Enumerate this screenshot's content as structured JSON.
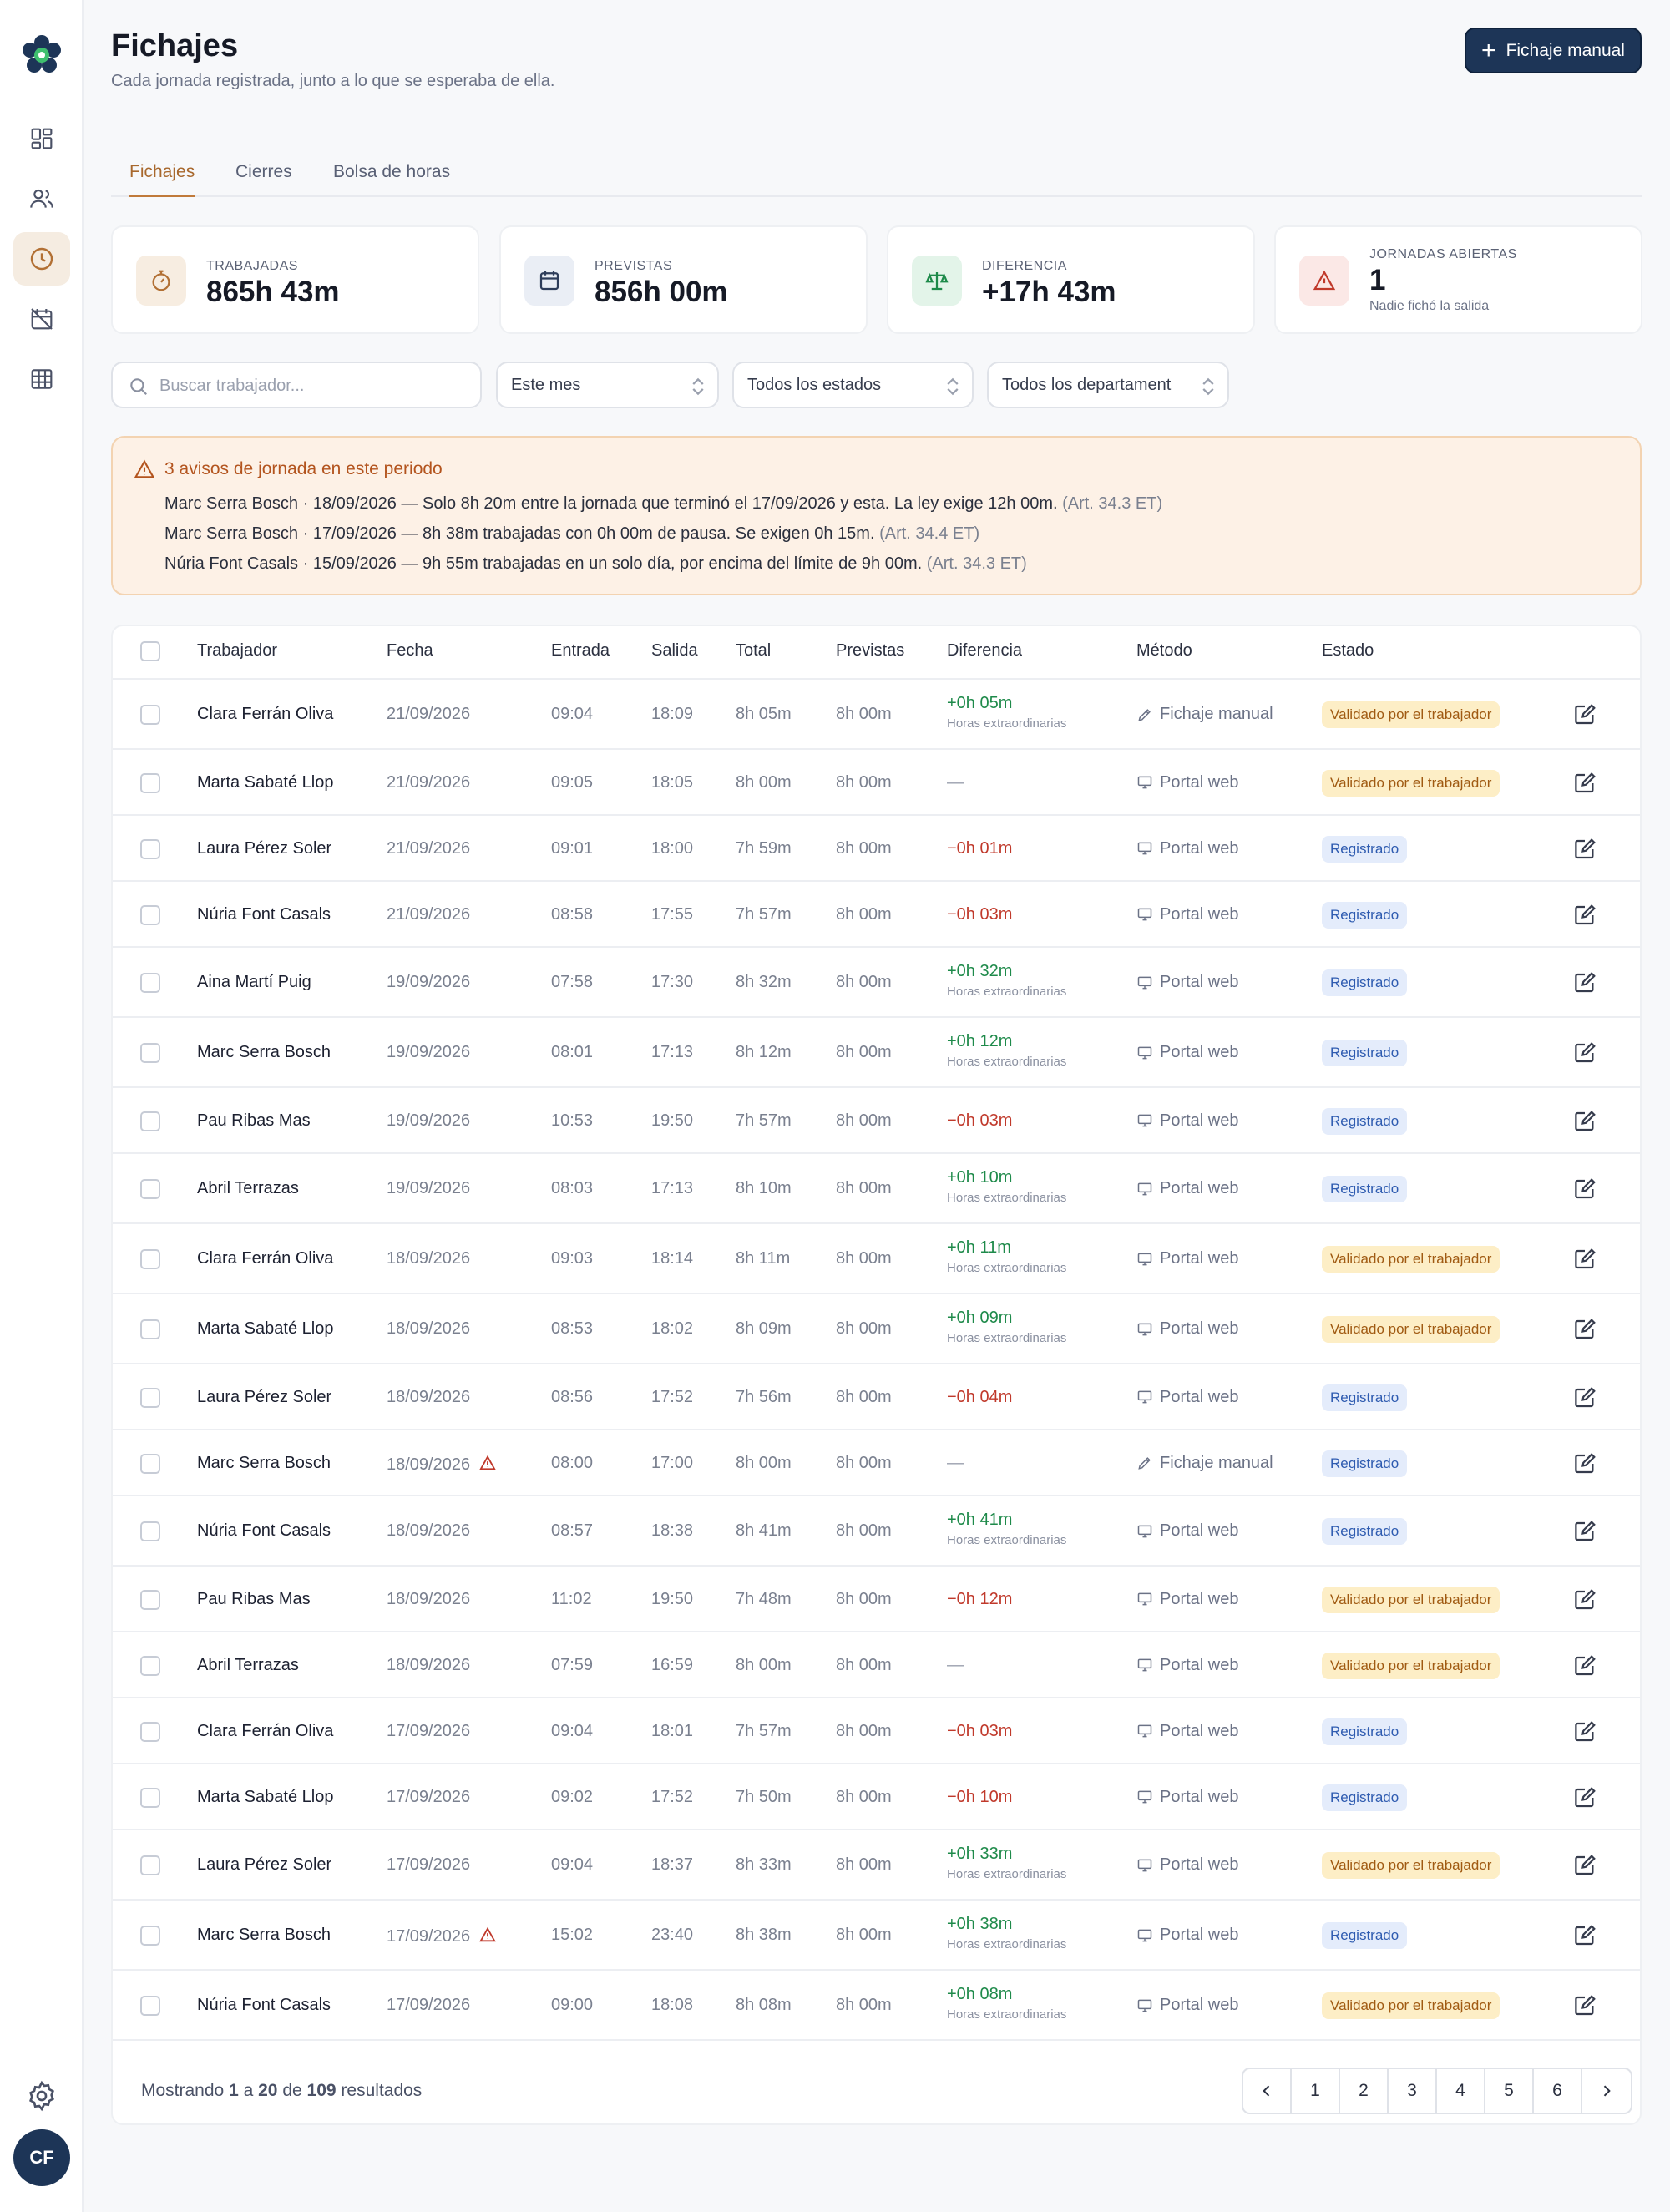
{
  "sidebar": {
    "items": [
      {
        "name": "dashboard",
        "icon": "grid-icon"
      },
      {
        "name": "users",
        "icon": "users-icon"
      },
      {
        "name": "fichajes",
        "icon": "clock-icon",
        "active": true
      },
      {
        "name": "calendar",
        "icon": "calendar-off-icon"
      },
      {
        "name": "table",
        "icon": "table-icon"
      }
    ],
    "avatar_initials": "CF"
  },
  "header": {
    "title": "Fichajes",
    "subtitle": "Cada jornada registrada, junto a lo que se esperaba de ella.",
    "primary_button": "Fichaje manual"
  },
  "tabs": [
    {
      "label": "Fichajes",
      "active": true
    },
    {
      "label": "Cierres",
      "active": false
    },
    {
      "label": "Bolsa de horas",
      "active": false
    }
  ],
  "stats": {
    "trabajadas": {
      "label": "TRABAJADAS",
      "value": "865h 43m"
    },
    "previstas": {
      "label": "PREVISTAS",
      "value": "856h 00m"
    },
    "diferencia": {
      "label": "DIFERENCIA",
      "value": "+17h 43m"
    },
    "abiertas": {
      "label": "JORNADAS ABIERTAS",
      "value": "1",
      "note": "Nadie fichó la salida"
    }
  },
  "filters": {
    "search_placeholder": "Buscar trabajador...",
    "period": "Este mes",
    "status": "Todos los estados",
    "department": "Todos los departament"
  },
  "alert": {
    "title": "3 avisos de jornada en este periodo",
    "lines": [
      {
        "text": "Marc Serra Bosch · 18/09/2026 — Solo 8h 20m entre la jornada que terminó el 17/09/2026 y esta. La ley exige 12h 00m.",
        "ref": "(Art. 34.3 ET)"
      },
      {
        "text": "Marc Serra Bosch · 17/09/2026 — 8h 38m trabajadas con 0h 00m de pausa. Se exigen 0h 15m.",
        "ref": "(Art. 34.4 ET)"
      },
      {
        "text": "Núria Font Casals · 15/09/2026 — 9h 55m trabajadas en un solo día, por encima del límite de 9h 00m.",
        "ref": "(Art. 34.3 ET)"
      }
    ]
  },
  "table": {
    "headers": {
      "worker": "Trabajador",
      "date": "Fecha",
      "in": "Entrada",
      "out": "Salida",
      "total": "Total",
      "planned": "Previstas",
      "diff": "Diferencia",
      "method": "Método",
      "status": "Estado"
    },
    "overtime_label": "Horas extraordinarias",
    "rows": [
      {
        "name": "Clara Ferrán Oliva",
        "date": "21/09/2026",
        "in": "09:04",
        "out": "18:09",
        "total": "8h 05m",
        "planned": "8h 00m",
        "diff": "+0h 05m",
        "diff_type": "pos",
        "method": "Fichaje manual",
        "method_icon": "pencil-icon",
        "status": "Validado por el trabajador",
        "status_type": "val"
      },
      {
        "name": "Marta Sabaté Llop",
        "date": "21/09/2026",
        "in": "09:05",
        "out": "18:05",
        "total": "8h 00m",
        "planned": "8h 00m",
        "diff": "—",
        "diff_type": "none",
        "method": "Portal web",
        "method_icon": "monitor-icon",
        "status": "Validado por el trabajador",
        "status_type": "val"
      },
      {
        "name": "Laura Pérez Soler",
        "date": "21/09/2026",
        "in": "09:01",
        "out": "18:00",
        "total": "7h 59m",
        "planned": "8h 00m",
        "diff": "−0h 01m",
        "diff_type": "neg",
        "method": "Portal web",
        "method_icon": "monitor-icon",
        "status": "Registrado",
        "status_type": "reg"
      },
      {
        "name": "Núria Font Casals",
        "date": "21/09/2026",
        "in": "08:58",
        "out": "17:55",
        "total": "7h 57m",
        "planned": "8h 00m",
        "diff": "−0h 03m",
        "diff_type": "neg",
        "method": "Portal web",
        "method_icon": "monitor-icon",
        "status": "Registrado",
        "status_type": "reg"
      },
      {
        "name": "Aina Martí Puig",
        "date": "19/09/2026",
        "in": "07:58",
        "out": "17:30",
        "total": "8h 32m",
        "planned": "8h 00m",
        "diff": "+0h 32m",
        "diff_type": "pos",
        "method": "Portal web",
        "method_icon": "monitor-icon",
        "status": "Registrado",
        "status_type": "reg"
      },
      {
        "name": "Marc Serra Bosch",
        "date": "19/09/2026",
        "in": "08:01",
        "out": "17:13",
        "total": "8h 12m",
        "planned": "8h 00m",
        "diff": "+0h 12m",
        "diff_type": "pos",
        "method": "Portal web",
        "method_icon": "monitor-icon",
        "status": "Registrado",
        "status_type": "reg"
      },
      {
        "name": "Pau Ribas Mas",
        "date": "19/09/2026",
        "in": "10:53",
        "out": "19:50",
        "total": "7h 57m",
        "planned": "8h 00m",
        "diff": "−0h 03m",
        "diff_type": "neg",
        "method": "Portal web",
        "method_icon": "monitor-icon",
        "status": "Registrado",
        "status_type": "reg"
      },
      {
        "name": "Abril Terrazas",
        "date": "19/09/2026",
        "in": "08:03",
        "out": "17:13",
        "total": "8h 10m",
        "planned": "8h 00m",
        "diff": "+0h 10m",
        "diff_type": "pos",
        "method": "Portal web",
        "method_icon": "monitor-icon",
        "status": "Registrado",
        "status_type": "reg"
      },
      {
        "name": "Clara Ferrán Oliva",
        "date": "18/09/2026",
        "in": "09:03",
        "out": "18:14",
        "total": "8h 11m",
        "planned": "8h 00m",
        "diff": "+0h 11m",
        "diff_type": "pos",
        "method": "Portal web",
        "method_icon": "monitor-icon",
        "status": "Validado por el trabajador",
        "status_type": "val"
      },
      {
        "name": "Marta Sabaté Llop",
        "date": "18/09/2026",
        "in": "08:53",
        "out": "18:02",
        "total": "8h 09m",
        "planned": "8h 00m",
        "diff": "+0h 09m",
        "diff_type": "pos",
        "method": "Portal web",
        "method_icon": "monitor-icon",
        "status": "Validado por el trabajador",
        "status_type": "val"
      },
      {
        "name": "Laura Pérez Soler",
        "date": "18/09/2026",
        "in": "08:56",
        "out": "17:52",
        "total": "7h 56m",
        "planned": "8h 00m",
        "diff": "−0h 04m",
        "diff_type": "neg",
        "method": "Portal web",
        "method_icon": "monitor-icon",
        "status": "Registrado",
        "status_type": "reg"
      },
      {
        "name": "Marc Serra Bosch",
        "date": "18/09/2026",
        "warning": true,
        "in": "08:00",
        "out": "17:00",
        "total": "8h 00m",
        "planned": "8h 00m",
        "diff": "—",
        "diff_type": "none",
        "method": "Fichaje manual",
        "method_icon": "pencil-icon",
        "status": "Registrado",
        "status_type": "reg"
      },
      {
        "name": "Núria Font Casals",
        "date": "18/09/2026",
        "in": "08:57",
        "out": "18:38",
        "total": "8h 41m",
        "planned": "8h 00m",
        "diff": "+0h 41m",
        "diff_type": "pos",
        "method": "Portal web",
        "method_icon": "monitor-icon",
        "status": "Registrado",
        "status_type": "reg"
      },
      {
        "name": "Pau Ribas Mas",
        "date": "18/09/2026",
        "in": "11:02",
        "out": "19:50",
        "total": "7h 48m",
        "planned": "8h 00m",
        "diff": "−0h 12m",
        "diff_type": "neg",
        "method": "Portal web",
        "method_icon": "monitor-icon",
        "status": "Validado por el trabajador",
        "status_type": "val"
      },
      {
        "name": "Abril Terrazas",
        "date": "18/09/2026",
        "in": "07:59",
        "out": "16:59",
        "total": "8h 00m",
        "planned": "8h 00m",
        "diff": "—",
        "diff_type": "none",
        "method": "Portal web",
        "method_icon": "monitor-icon",
        "status": "Validado por el trabajador",
        "status_type": "val"
      },
      {
        "name": "Clara Ferrán Oliva",
        "date": "17/09/2026",
        "in": "09:04",
        "out": "18:01",
        "total": "7h 57m",
        "planned": "8h 00m",
        "diff": "−0h 03m",
        "diff_type": "neg",
        "method": "Portal web",
        "method_icon": "monitor-icon",
        "status": "Registrado",
        "status_type": "reg"
      },
      {
        "name": "Marta Sabaté Llop",
        "date": "17/09/2026",
        "in": "09:02",
        "out": "17:52",
        "total": "7h 50m",
        "planned": "8h 00m",
        "diff": "−0h 10m",
        "diff_type": "neg",
        "method": "Portal web",
        "method_icon": "monitor-icon",
        "status": "Registrado",
        "status_type": "reg"
      },
      {
        "name": "Laura Pérez Soler",
        "date": "17/09/2026",
        "in": "09:04",
        "out": "18:37",
        "total": "8h 33m",
        "planned": "8h 00m",
        "diff": "+0h 33m",
        "diff_type": "pos",
        "method": "Portal web",
        "method_icon": "monitor-icon",
        "status": "Validado por el trabajador",
        "status_type": "val"
      },
      {
        "name": "Marc Serra Bosch",
        "date": "17/09/2026",
        "warning": true,
        "in": "15:02",
        "out": "23:40",
        "total": "8h 38m",
        "planned": "8h 00m",
        "diff": "+0h 38m",
        "diff_type": "pos",
        "method": "Portal web",
        "method_icon": "monitor-icon",
        "status": "Registrado",
        "status_type": "reg"
      },
      {
        "name": "Núria Font Casals",
        "date": "17/09/2026",
        "in": "09:00",
        "out": "18:08",
        "total": "8h 08m",
        "planned": "8h 00m",
        "diff": "+0h 08m",
        "diff_type": "pos",
        "method": "Portal web",
        "method_icon": "monitor-icon",
        "status": "Validado por el trabajador",
        "status_type": "val"
      }
    ]
  },
  "pagination": {
    "prefix": "Mostrando",
    "from": "1",
    "mid1": "a",
    "to": "20",
    "mid2": "de",
    "total": "109",
    "suffix": "resultados",
    "pages": [
      "1",
      "2",
      "3",
      "4",
      "5",
      "6"
    ]
  },
  "colors": {
    "primary": "#1d3557",
    "accent": "#c07a3a",
    "positive": "#1e8a4a",
    "negative": "#c0392b",
    "badge_validated_bg": "#fdeec6",
    "badge_registered_bg": "#e4ecfb"
  }
}
